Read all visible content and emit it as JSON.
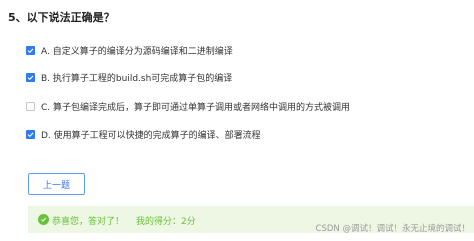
{
  "question": {
    "title": "5、以下说法正确是？"
  },
  "options": [
    {
      "text": "A. 自定义算子的编译分为源码编译和二进制编译",
      "checked": true
    },
    {
      "text": "B. 执行算子工程的build.sh可完成算子包的编译",
      "checked": true
    },
    {
      "text": "C. 算子包编译完成后，算子即可通过单算子调用或者网络中调用的方式被调用",
      "checked": false
    },
    {
      "text": "D. 使用算子工程可以快捷的完成算子的编译、部署流程",
      "checked": true
    }
  ],
  "nav": {
    "prev_label": "上一题"
  },
  "result": {
    "message": "恭喜您，答对了！",
    "score_label": "我的得分：",
    "score": "2分"
  },
  "watermark": "CSDN @调试！调试！永无止境的调试！",
  "colors": {
    "accent": "#2f7bf5",
    "success": "#67c23a",
    "result_bg": "#eef7e4"
  }
}
